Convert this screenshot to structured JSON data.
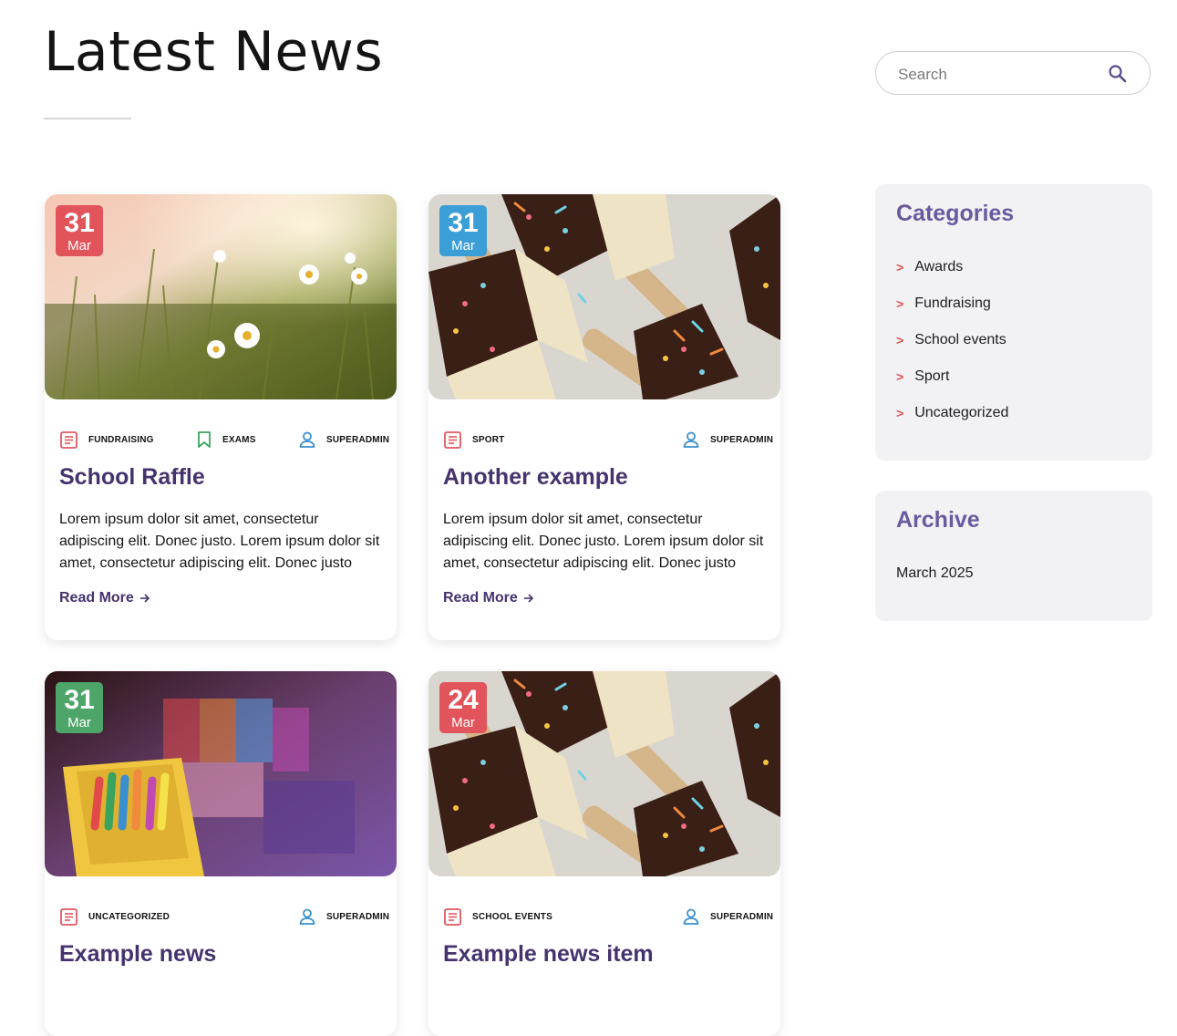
{
  "page": {
    "title": "Latest News"
  },
  "search": {
    "placeholder": "Search"
  },
  "colors": {
    "badge_red": "#e2545c",
    "badge_blue": "#3b9ed7",
    "badge_green": "#4ea56a",
    "accent_purple": "#46336e",
    "icon_red": "#e0575e",
    "icon_green": "#3aa35d",
    "icon_blue": "#3a8fd0"
  },
  "posts": [
    {
      "day": "31",
      "month": "Mar",
      "image": "daisies-photo",
      "category": "FUNDRAISING",
      "tag": "EXAMS",
      "author": "SUPERADMIN",
      "title": "School Raffle",
      "excerpt": "Lorem ipsum dolor sit amet, consectetur adipiscing elit. Donec justo. Lorem ipsum dolor sit amet, consectetur adipiscing elit. Donec justo",
      "read_more": "Read More"
    },
    {
      "day": "31",
      "month": "Mar",
      "image": "rice-crispy-pops-photo",
      "category": "SPORT",
      "author": "SUPERADMIN",
      "title": "Another example",
      "excerpt": "Lorem ipsum dolor sit amet, consectetur adipiscing elit. Donec justo. Lorem ipsum dolor sit amet, consectetur adipiscing elit. Donec justo",
      "read_more": "Read More"
    },
    {
      "day": "31",
      "month": "Mar",
      "image": "crayons-photo",
      "category": "UNCATEGORIZED",
      "author": "SUPERADMIN",
      "title": "Example news"
    },
    {
      "day": "24",
      "month": "Mar",
      "image": "rice-crispy-pops-photo",
      "category": "SCHOOL EVENTS",
      "author": "SUPERADMIN",
      "title": "Example news item"
    }
  ],
  "sidebar": {
    "categories": {
      "title": "Categories",
      "items": [
        "Awards",
        "Fundraising",
        "School events",
        "Sport",
        "Uncategorized"
      ]
    },
    "archive": {
      "title": "Archive",
      "items": [
        "March 2025"
      ]
    }
  },
  "icons": {
    "search": "search-icon",
    "category": "document-icon",
    "tag": "bookmark-icon",
    "author": "user-icon",
    "read_more": "arrow-right-icon",
    "chevron": "chevron-right-icon"
  }
}
